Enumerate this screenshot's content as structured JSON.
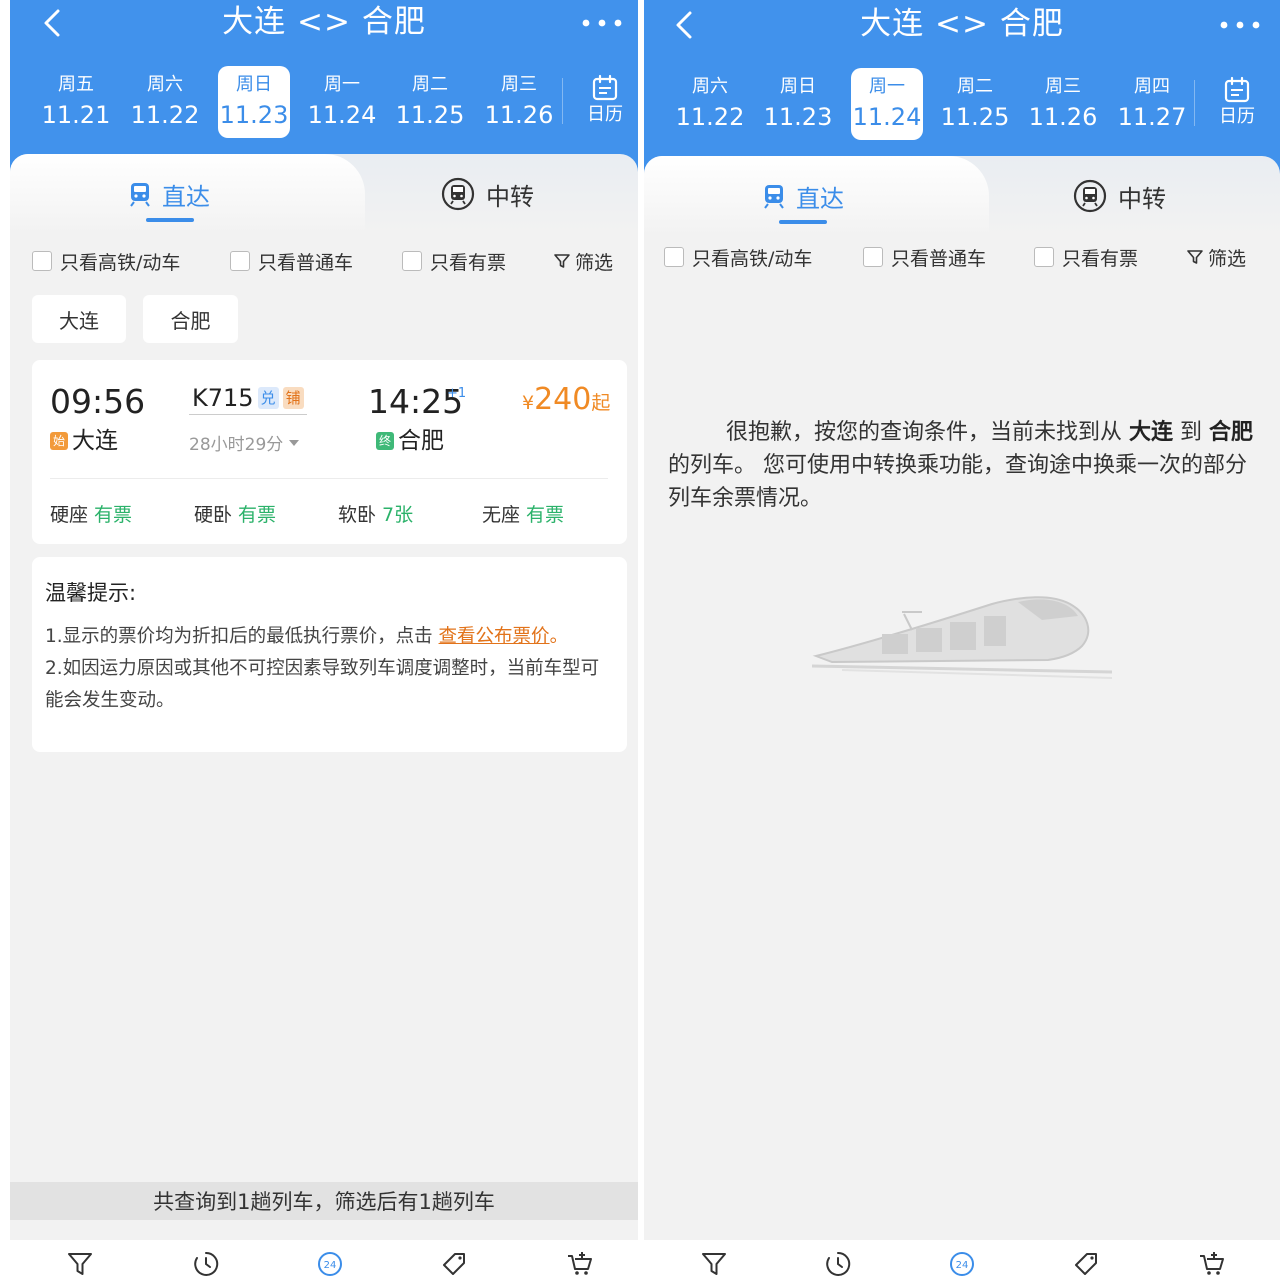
{
  "left": {
    "title": "大连 <> 合肥",
    "dates": [
      {
        "day": "周五",
        "date": "11.21"
      },
      {
        "day": "周六",
        "date": "11.22"
      },
      {
        "day": "周日",
        "date": "11.23"
      },
      {
        "day": "周一",
        "date": "11.24"
      },
      {
        "day": "周二",
        "date": "11.25"
      },
      {
        "day": "周三",
        "date": "11.26"
      }
    ],
    "active_date_index": 2,
    "calendar_label": "日历",
    "tabs": {
      "direct": "直达",
      "transfer": "中转"
    },
    "filters": {
      "high_speed": "只看高铁/动车",
      "normal": "只看普通车",
      "available": "只看有票",
      "filter": "筛选"
    },
    "stations": {
      "from": "大连",
      "to": "合肥"
    },
    "train": {
      "dep_time": "09:56",
      "dep_badge": "始",
      "dep_station": "大连",
      "number": "K715",
      "tag1": "兑",
      "tag2": "铺",
      "duration": "28小时29分",
      "arr_time": "14:25",
      "plus_day": "+1",
      "arr_badge": "终",
      "arr_station": "合肥",
      "price_symbol": "¥",
      "price": "240",
      "price_suffix": "起",
      "seats": [
        {
          "name": "硬座",
          "status": "有票"
        },
        {
          "name": "硬卧",
          "status": "有票"
        },
        {
          "name": "软卧",
          "status": "7张"
        },
        {
          "name": "无座",
          "status": "有票"
        }
      ]
    },
    "tips": {
      "title": "温馨提示:",
      "line1_prefix": "1.显示的票价均为折扣后的最低执行票价，点击 ",
      "line1_link": "查看公布票价",
      "line1_suffix": "。",
      "line2": "2.如因运力原因或其他不可控因素导致列车调度调整时，当前车型可能会发生变动。"
    },
    "summary": "共查询到1趟列车，筛选后有1趟列车"
  },
  "right": {
    "title": "大连 <> 合肥",
    "dates": [
      {
        "day": "周六",
        "date": "11.22"
      },
      {
        "day": "周日",
        "date": "11.23"
      },
      {
        "day": "周一",
        "date": "11.24"
      },
      {
        "day": "周二",
        "date": "11.25"
      },
      {
        "day": "周三",
        "date": "11.26"
      },
      {
        "day": "周四",
        "date": "11.27"
      }
    ],
    "active_date_index": 2,
    "calendar_label": "日历",
    "tabs": {
      "direct": "直达",
      "transfer": "中转"
    },
    "filters": {
      "high_speed": "只看高铁/动车",
      "normal": "只看普通车",
      "available": "只看有票",
      "filter": "筛选"
    },
    "empty": {
      "part1": "很抱歉，按您的查询条件，当前未找到从 ",
      "from": "大连",
      "part2": " 到 ",
      "to": "合肥",
      "part3": " 的列车。 您可使用中转换乘功能，查询途中换乘一次的部分列车余票情况。"
    }
  },
  "bottom_nav": {
    "calendar_24": "24"
  },
  "colors": {
    "header_blue": "#4192ec",
    "accent_blue": "#3b8de9",
    "price_orange": "#f08a24",
    "available_green": "#2bb26a"
  }
}
